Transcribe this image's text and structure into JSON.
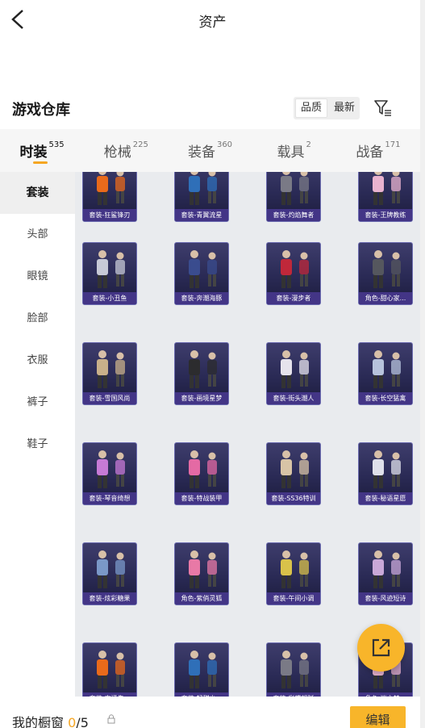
{
  "header": {
    "title": "资产"
  },
  "warehouse": {
    "title": "游戏仓库",
    "sort_options": [
      "品质",
      "最新"
    ],
    "active_sort": 0
  },
  "tabs": [
    {
      "label": "时装",
      "count": "535"
    },
    {
      "label": "枪械",
      "count": "225"
    },
    {
      "label": "装备",
      "count": "360"
    },
    {
      "label": "载具",
      "count": "2"
    },
    {
      "label": "战备",
      "count": "171"
    }
  ],
  "sidebar": {
    "items": [
      {
        "label": "套装"
      },
      {
        "label": "头部"
      },
      {
        "label": "眼镜"
      },
      {
        "label": "脸部"
      },
      {
        "label": "衣服"
      },
      {
        "label": "裤子"
      },
      {
        "label": "鞋子"
      }
    ]
  },
  "items": [
    {
      "name": "套装-狂鲨锋刃"
    },
    {
      "name": "套装-青翼流星"
    },
    {
      "name": "套装-灼焰舞者"
    },
    {
      "name": "套装-王牌教练"
    },
    {
      "name": "套装-小丑鱼"
    },
    {
      "name": "套装-奔潮海豚"
    },
    {
      "name": "套装-漫步者"
    },
    {
      "name": "角色-甜心家..."
    },
    {
      "name": "套装-雪国风尚"
    },
    {
      "name": "套装-画境星梦"
    },
    {
      "name": "套装-街头潮人"
    },
    {
      "name": "套装-长空猛禽"
    },
    {
      "name": "套装-琴音绮想"
    },
    {
      "name": "套装-特战装甲"
    },
    {
      "name": "套装-SS36特训"
    },
    {
      "name": "套装-秘语星愿"
    },
    {
      "name": "套装-炫彩糖果"
    },
    {
      "name": "角色-紫俏灵狐"
    },
    {
      "name": "套装-午间小调"
    },
    {
      "name": "套装-风迹短诗"
    },
    {
      "name": "套装-奔涌先..."
    },
    {
      "name": "套装-轻甜少..."
    },
    {
      "name": "套装-彩蝶翩跹"
    },
    {
      "name": "角色-迷之梦..."
    }
  ],
  "bottom": {
    "label": "我的橱窗",
    "count": "0",
    "total": "/5",
    "edit_label": "编辑"
  },
  "colors": {
    "accent": "#f8b52a",
    "item_bg": "#2a2a55",
    "item_label_bg": "#46378c"
  },
  "icons": {
    "back": "chevron-left-icon",
    "filter": "filter-icon",
    "lock": "lock-icon",
    "share": "share-external-icon"
  }
}
